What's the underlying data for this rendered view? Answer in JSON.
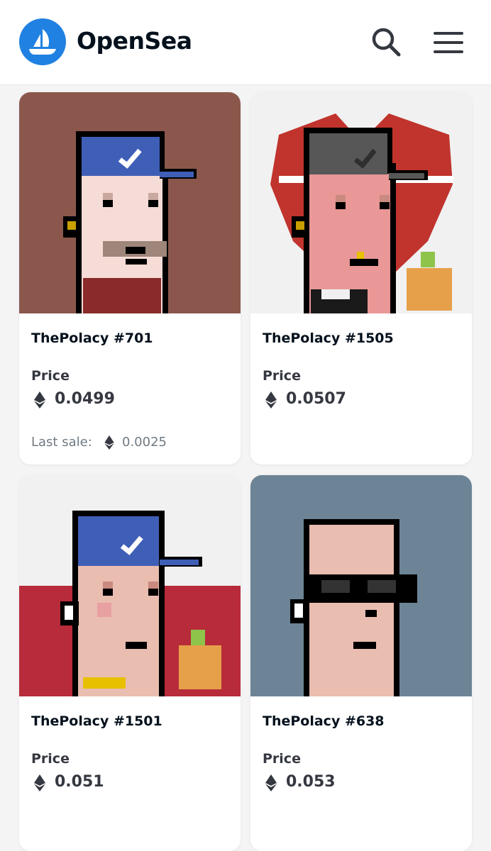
{
  "header": {
    "brand": "OpenSea",
    "logo_icon": "opensea-sailboat-icon",
    "search_icon": "search-icon",
    "menu_icon": "hamburger-menu-icon",
    "brand_color": "#2081e2"
  },
  "items": [
    {
      "name": "ThePolacy #701",
      "price_label": "Price",
      "price": "0.0499",
      "last_sale_label": "Last sale:",
      "last_sale": "0.0025",
      "background": "#8b574c"
    },
    {
      "name": "ThePolacy #1505",
      "price_label": "Price",
      "price": "0.0507",
      "background": "#f1f1f1"
    },
    {
      "name": "ThePolacy #1501",
      "price_label": "Price",
      "price": "0.051",
      "background": "#b82b3a"
    },
    {
      "name": "ThePolacy #638",
      "price_label": "Price",
      "price": "0.053",
      "background": "#6c8495"
    }
  ],
  "currency_icon": "ethereum-icon"
}
